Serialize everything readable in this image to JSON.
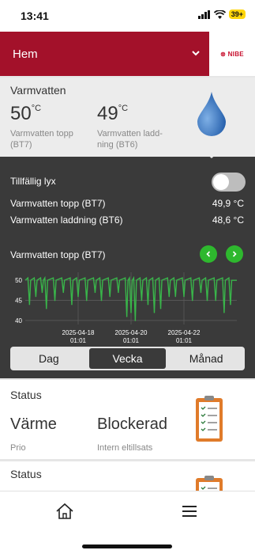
{
  "status_bar": {
    "time": "13:41",
    "battery": "39+"
  },
  "nav": {
    "title": "Hem",
    "logo": "⊗ NIBE"
  },
  "hot_water": {
    "title": "Varmvatten",
    "top_value": "50",
    "top_unit": "°C",
    "top_label_1": "Varmvatten topp",
    "top_label_2": "(BT7)",
    "charge_value": "49",
    "charge_unit": "°C",
    "charge_label_1": "Varmvatten ladd-",
    "charge_label_2": "ning (BT6)"
  },
  "details": {
    "lux_label": "Tillfällig lyx",
    "lux_on": false,
    "rows": [
      {
        "label": "Varmvatten topp (BT7)",
        "value": "49,9 °C"
      },
      {
        "label": "Varmvatten laddning (BT6)",
        "value": "48,6 °C"
      }
    ],
    "chart_title": "Varmvatten topp (BT7)"
  },
  "chart_data": {
    "type": "line",
    "title": "Varmvatten topp (BT7)",
    "y_ticks": [
      "50",
      "45",
      "40"
    ],
    "ylim": [
      39,
      52
    ],
    "x_ticks": [
      {
        "date": "2025-04-18",
        "time": "01:01"
      },
      {
        "date": "2025-04-20",
        "time": "01:01"
      },
      {
        "date": "2025-04-22",
        "time": "01:01"
      }
    ],
    "x_tick_at": [
      0.25,
      0.5,
      0.75
    ],
    "series": [
      {
        "color": "#39b54a",
        "base": 50,
        "dips": [
          {
            "x": 0.02,
            "y": 44
          },
          {
            "x": 0.05,
            "y": 46
          },
          {
            "x": 0.08,
            "y": 47
          },
          {
            "x": 0.1,
            "y": 43
          },
          {
            "x": 0.14,
            "y": 45
          },
          {
            "x": 0.18,
            "y": 47
          },
          {
            "x": 0.22,
            "y": 44
          },
          {
            "x": 0.25,
            "y": 46
          },
          {
            "x": 0.29,
            "y": 45
          },
          {
            "x": 0.33,
            "y": 47
          },
          {
            "x": 0.36,
            "y": 45
          },
          {
            "x": 0.4,
            "y": 46
          },
          {
            "x": 0.44,
            "y": 47
          },
          {
            "x": 0.48,
            "y": 41
          },
          {
            "x": 0.5,
            "y": 42
          },
          {
            "x": 0.52,
            "y": 40
          },
          {
            "x": 0.55,
            "y": 45
          },
          {
            "x": 0.58,
            "y": 44
          },
          {
            "x": 0.61,
            "y": 42
          },
          {
            "x": 0.64,
            "y": 43
          },
          {
            "x": 0.68,
            "y": 46
          },
          {
            "x": 0.71,
            "y": 46
          },
          {
            "x": 0.75,
            "y": 46
          },
          {
            "x": 0.79,
            "y": 45
          },
          {
            "x": 0.83,
            "y": 47
          },
          {
            "x": 0.86,
            "y": 45
          },
          {
            "x": 0.9,
            "y": 45
          },
          {
            "x": 0.94,
            "y": 42
          },
          {
            "x": 0.97,
            "y": 44
          }
        ]
      }
    ],
    "grid": true
  },
  "tabs": {
    "day": "Dag",
    "week": "Vecka",
    "month": "Månad",
    "active": "week"
  },
  "status1": {
    "title": "Status",
    "left_big": "Värme",
    "left_small": "Prio",
    "right_big": "Blockerad",
    "right_small": "Intern eltillsats"
  },
  "status2": {
    "title": "Status"
  },
  "icons": {
    "home": "home-icon",
    "menu": "menu-icon"
  }
}
